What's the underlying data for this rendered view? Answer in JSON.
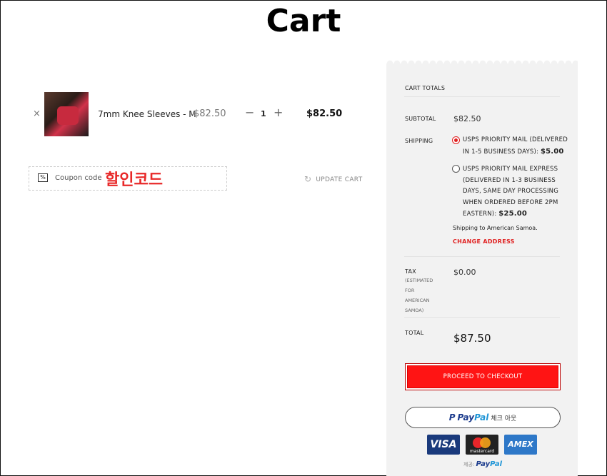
{
  "page": {
    "title": "Cart"
  },
  "cart_item": {
    "remove": "×",
    "name": "7mm Knee Sleeves - M",
    "price": "$82.50",
    "qty_minus": "−",
    "qty": "1",
    "qty_plus": "+",
    "subtotal": "$82.50"
  },
  "coupon": {
    "icon": "%",
    "placeholder": "Coupon code",
    "annotation": "할인코드"
  },
  "update_cart": {
    "icon": "↻",
    "label": "UPDATE CART"
  },
  "totals": {
    "heading": "CART TOTALS",
    "subtotal_label": "SUBTOTAL",
    "subtotal_value": "$82.50",
    "shipping_label": "SHIPPING",
    "options": [
      {
        "lines": [
          "USPS PRIORITY MAIL (DELIVERED",
          "IN 1-5 BUSINESS DAYS): "
        ],
        "price": "$5.00",
        "selected": true
      },
      {
        "lines": [
          "USPS PRIORITY MAIL EXPRESS",
          "(DELIVERED IN 1-3 BUSINESS",
          "DAYS, SAME DAY PROCESSING",
          "WHEN ORDERED BEFORE 2PM",
          "EASTERN): "
        ],
        "price": "$25.00",
        "selected": false
      }
    ],
    "shipping_to": "Shipping to American Samoa.",
    "change_address": "CHANGE ADDRESS",
    "tax_label": "TAX",
    "tax_note": [
      "(ESTIMATED",
      "FOR",
      "AMERICAN",
      "SAMOA)"
    ],
    "tax_value": "$0.00",
    "total_label": "TOTAL",
    "total_value": "$87.50",
    "checkout": "PROCEED TO CHECKOUT",
    "paypal": {
      "pay": "Pay",
      "pal": "Pal",
      "suffix": "체크 아웃"
    },
    "cards": [
      "VISA",
      "mastercard",
      "AMEX"
    ],
    "powered_by": {
      "prefix": "제공:",
      "pay": "Pay",
      "pal": "Pal"
    }
  },
  "colors": {
    "accent": "#e02020",
    "panel": "#f2f2f2",
    "paypal_dark": "#1a3a8c",
    "paypal_light": "#1f95d6"
  }
}
